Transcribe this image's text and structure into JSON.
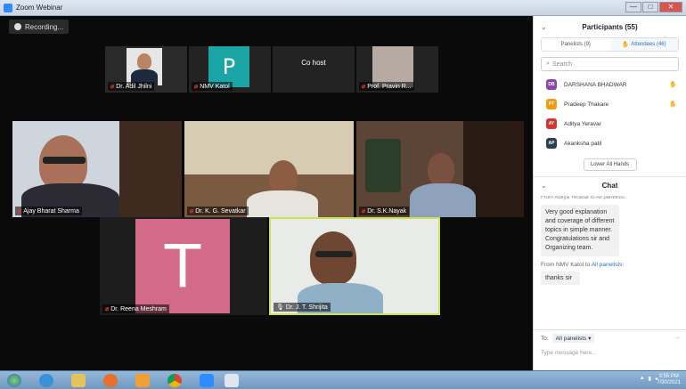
{
  "window": {
    "title": "Zoom Webinar",
    "controls": [
      "—",
      "□",
      "✕"
    ]
  },
  "recording": {
    "label": "Recording..."
  },
  "video_tiles": {
    "top": [
      {
        "name": "Dr. Adil Jhilni",
        "muted": true
      },
      {
        "name": "NMV Katol",
        "letter": "P",
        "muted": true
      },
      {
        "name": "Co host",
        "label_only": true
      },
      {
        "name": "Prof. Pravin R...",
        "muted": true
      }
    ],
    "middle": [
      {
        "name": "Ajay Bharat Sharma",
        "muted": true
      },
      {
        "name": "Dr. K. G. Sevatkar",
        "muted": true
      },
      {
        "name": "Dr. S.K.Nayak",
        "muted": true
      }
    ],
    "bottom": [
      {
        "name": "Dr. Reena Meshram",
        "letter": "T",
        "muted": true
      },
      {
        "name": "Dr. J. T. Shrijita",
        "muted": false,
        "active_speaker": true
      }
    ]
  },
  "participants": {
    "title": "Participants (55)",
    "tabs": {
      "panelists": "Panelists (9)",
      "attendees": "Attendees (46)"
    },
    "search_placeholder": "Search",
    "list": [
      {
        "initials": "DB",
        "name": "DARSHANA BHADWAR",
        "color": "#8e44ad",
        "hand": true
      },
      {
        "initials": "PT",
        "name": "Pradeep Thakare",
        "color": "#f39c12",
        "hand": true
      },
      {
        "initials": "AY",
        "name": "Aditya Yeravar",
        "color": "#d9342b",
        "hand": false
      },
      {
        "initials": "AP",
        "name": "Akanksha patil",
        "color": "#2c3e50",
        "hand": false
      }
    ],
    "lower_hands": "Lower All Hands"
  },
  "chat": {
    "title": "Chat",
    "cut_line": "From Aditya Yeravar to All panelists:",
    "message1": "Very good explanation and coverage of different topics in simple manner. Congratulations sir and Organizing team.",
    "from2_prefix": "From NMV Katol to",
    "from2_target": "All panelists:",
    "message2": "thanks sir",
    "to_label": "To:",
    "to_value": "All panelists ▾",
    "more": "...",
    "input_placeholder": "Type message here..."
  },
  "taskbar": {
    "clock_time": "3:55 PM",
    "clock_date": "7/30/2021"
  }
}
